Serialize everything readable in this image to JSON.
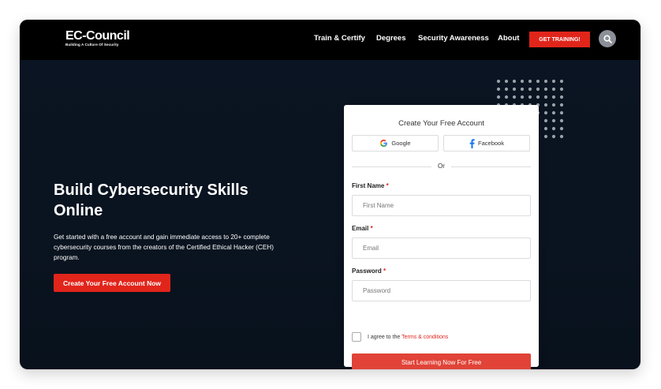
{
  "header": {
    "logo_name": "EC-Council",
    "logo_tagline": "Building A Culture Of Security",
    "nav": [
      {
        "label": "Train & Certify"
      },
      {
        "label": "Degrees"
      },
      {
        "label": "Security Awareness"
      },
      {
        "label": "About"
      }
    ],
    "cta_label": "GET TRAINING!",
    "search_icon": "search-icon"
  },
  "hero": {
    "title": "Build Cybersecurity Skills Online",
    "description": "Get started with a free account and gain immediate access to 20+ complete cybersecurity courses from the creators of the Certified Ethical Hacker (CEH) program.",
    "cta_label": "Create Your Free Account Now"
  },
  "signup": {
    "title": "Create Your Free Account",
    "google_label": "Google",
    "facebook_label": "Facebook",
    "or_label": "Or",
    "first_name": {
      "label": "First Name",
      "required_mark": "*",
      "placeholder": "First Name",
      "value": ""
    },
    "email": {
      "label": "Email",
      "required_mark": "*",
      "placeholder": "Email",
      "value": ""
    },
    "password": {
      "label": "Password",
      "required_mark": "*",
      "placeholder": "Password",
      "value": ""
    },
    "agree_prefix": "I agree to the",
    "terms_label": "Terms & conditions",
    "agree_checked": false,
    "submit_label": "Start Learning Now For Free"
  },
  "colors": {
    "accent_red": "#e1251b",
    "header_bg": "#000000",
    "hero_bg": "#0b1422",
    "google_blue": "#4285F4",
    "facebook_blue": "#1877F2"
  }
}
